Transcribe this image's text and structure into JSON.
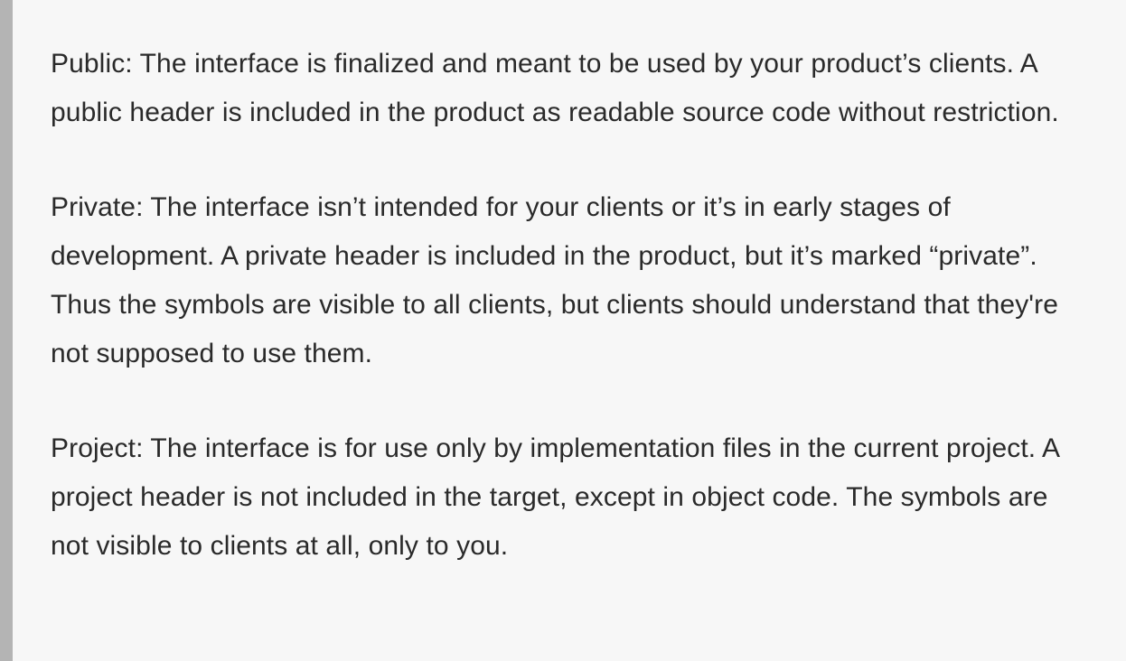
{
  "quote": {
    "paragraphs": [
      "Public: The interface is finalized and meant to be used by your product’s clients. A public header is included in the product as readable source code without restriction.",
      "Private: The interface isn’t intended for your clients or it’s in early stages of development. A private header is included in the product, but it’s marked “private”. Thus the symbols are visible to all clients, but clients should understand that they're not supposed to use them.",
      "Project: The interface is for use only by implementation files in the current project. A project header is not included in the target, except in object code. The symbols are not visible to clients at all, only to you."
    ]
  },
  "colors": {
    "background": "#f7f7f7",
    "border": "#b4b4b4",
    "text": "#2a2a2a"
  }
}
